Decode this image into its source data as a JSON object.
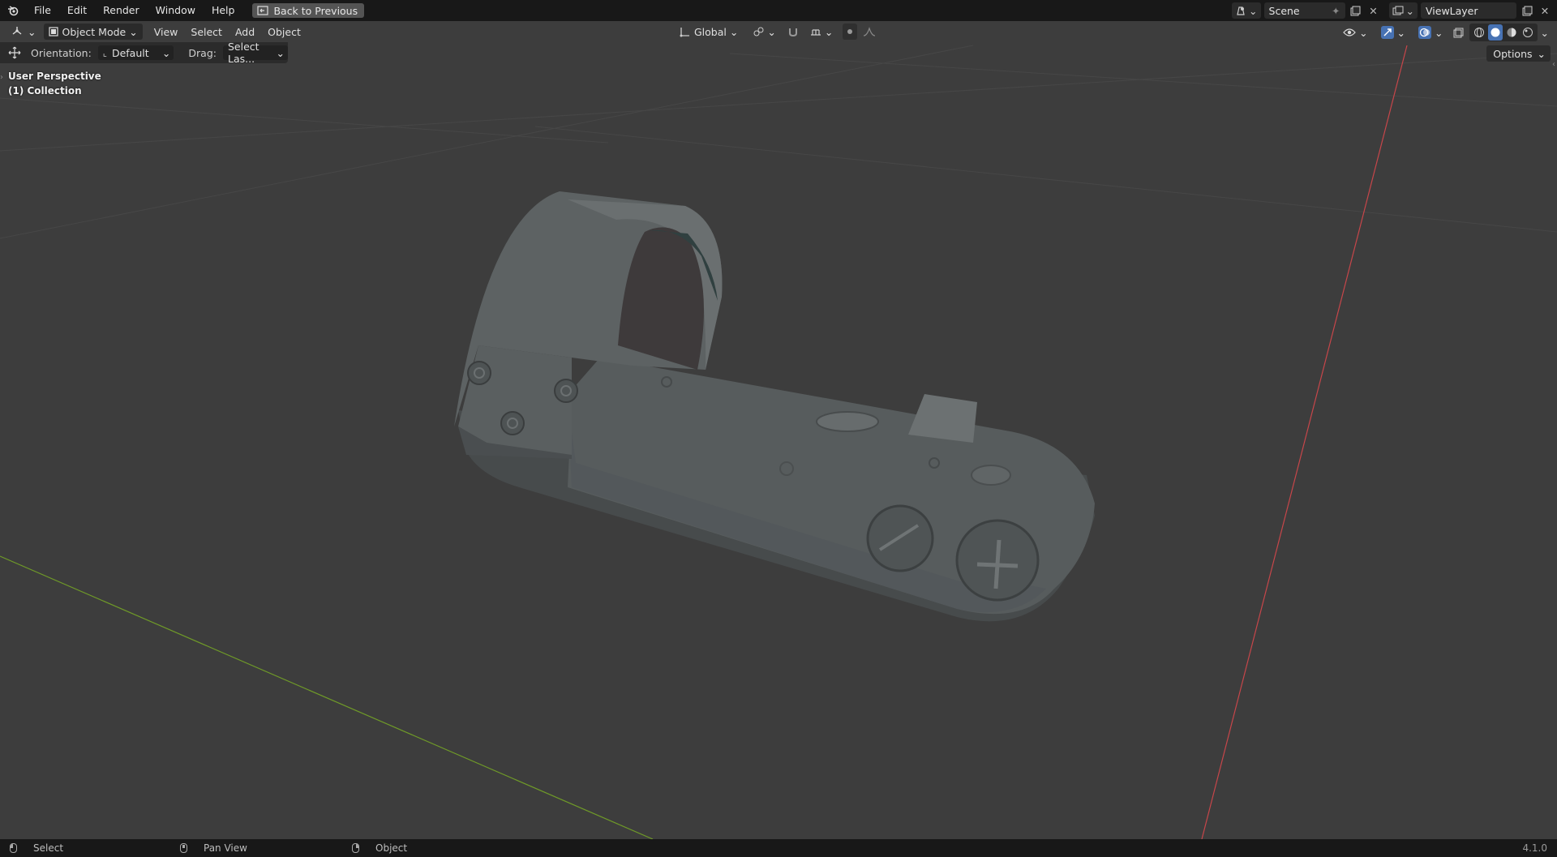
{
  "topbar": {
    "menus": [
      "File",
      "Edit",
      "Render",
      "Window",
      "Help"
    ],
    "back_label": "Back to Previous",
    "scene_name": "Scene",
    "view_layer_name": "ViewLayer"
  },
  "header": {
    "mode_label": "Object Mode",
    "menus": [
      "View",
      "Select",
      "Add",
      "Object"
    ],
    "transform_orientation": "Global"
  },
  "tool_header": {
    "orientation_label": "Orientation:",
    "orientation_value": "Default",
    "drag_label": "Drag:",
    "drag_value": "Select Las..."
  },
  "options_label": "Options",
  "viewport": {
    "perspective_label": "User Perspective",
    "collection_label": "(1) Collection"
  },
  "status": {
    "select_label": "Select",
    "pan_label": "Pan View",
    "object_label": "Object",
    "version": "4.1.0"
  },
  "icons": {
    "logo": "blender-logo-icon",
    "editor": "3d-viewport-editor-icon",
    "transform": "move-tool-icon"
  },
  "colors": {
    "viewport_bg": "#3d3d3d",
    "x_axis": "#d04a4a",
    "y_axis": "#7aa02c",
    "active_blue": "#4772b3"
  }
}
